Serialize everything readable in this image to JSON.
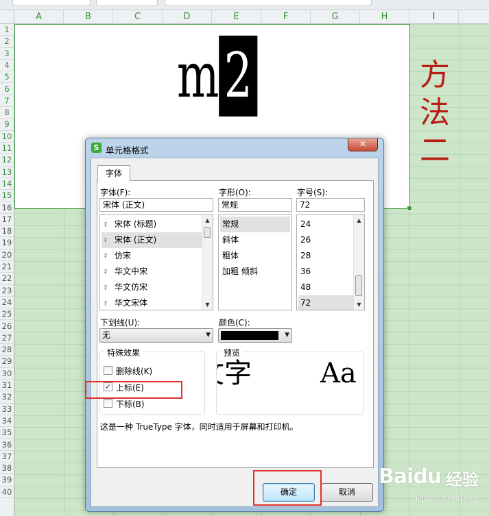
{
  "spreadsheet": {
    "columns": [
      "A",
      "B",
      "C",
      "D",
      "E",
      "F",
      "G",
      "H",
      "I"
    ],
    "rows": [
      "1",
      "2",
      "3",
      "4",
      "5",
      "6",
      "7",
      "8",
      "9",
      "10",
      "11",
      "12",
      "13",
      "14",
      "15",
      "16",
      "17",
      "18",
      "19",
      "20",
      "21",
      "22",
      "23",
      "24",
      "25",
      "26",
      "27",
      "28",
      "29",
      "30",
      "31",
      "32",
      "33",
      "34",
      "35",
      "36",
      "37",
      "38",
      "39",
      "40"
    ],
    "cell_text_base": "m",
    "cell_text_sup": "2",
    "side_text": [
      "方",
      "法",
      "二"
    ],
    "side_text_color": "#b81c14",
    "selection_color": "#3c9a3c"
  },
  "dialog": {
    "title": "单元格格式",
    "app_icon_glyph": "S",
    "close_glyph": "✕",
    "tab_font": "字体",
    "font_label": "字体(F):",
    "font_value": "宋体 (正文)",
    "font_list": [
      "宋体 (标题)",
      "宋体 (正文)",
      "仿宋",
      "华文中宋",
      "华文仿宋",
      "华文宋体"
    ],
    "font_selected_index": 1,
    "style_label": "字形(O):",
    "style_value": "常规",
    "style_list": [
      "常规",
      "斜体",
      "粗体",
      "加粗 倾斜"
    ],
    "style_selected_index": 0,
    "size_label": "字号(S):",
    "size_value": "72",
    "size_list": [
      "24",
      "26",
      "28",
      "36",
      "48",
      "72"
    ],
    "size_selected_index": 5,
    "underline_label": "下划线(U):",
    "underline_value": "无",
    "color_label": "颜色(C):",
    "color_value": "#000000",
    "effects_title": "特殊效果",
    "strikethrough_label": "删除线(K)",
    "strikethrough_checked": false,
    "superscript_label": "上标(E)",
    "superscript_checked": true,
    "subscript_label": "下标(B)",
    "subscript_checked": false,
    "preview_title": "预览",
    "preview_text_left": "文字",
    "preview_text_right": "Aa",
    "info_text": "这是一种 TrueType 字体，同时适用于屏幕和打印机。",
    "ok_label": "确定",
    "cancel_label": "取消",
    "checkmark_glyph": "✓",
    "scroll_up_glyph": "▲",
    "scroll_down_glyph": "▼",
    "dropdown_glyph": "▼",
    "font_item_icon_glyph": "Ŧ"
  },
  "watermark": {
    "logo": "Baidu",
    "cn": "经验",
    "url": "jingyan.baidu.com"
  }
}
